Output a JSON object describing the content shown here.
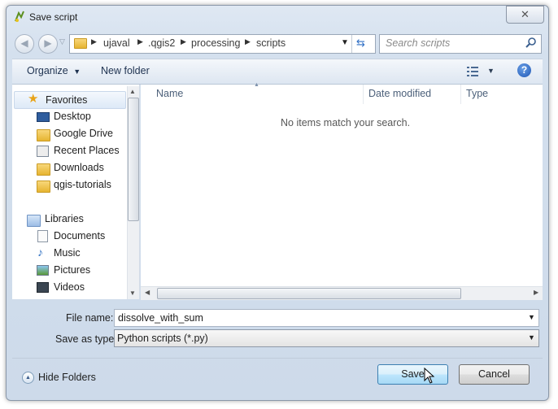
{
  "window": {
    "title": "Save script",
    "close_glyph": "✕"
  },
  "address_bar": {
    "segments": [
      "ujaval",
      ".qgis2",
      "processing",
      "scripts"
    ],
    "refresh_glyph": "⇆"
  },
  "search": {
    "placeholder": "Search scripts"
  },
  "toolbar": {
    "organize_label": "Organize",
    "new_folder_label": "New folder",
    "help_glyph": "?"
  },
  "nav_pane": {
    "favorites_label": "Favorites",
    "favorites": [
      "Desktop",
      "Google Drive",
      "Recent Places",
      "Downloads",
      "qgis-tutorials"
    ],
    "libraries_label": "Libraries",
    "libraries": [
      "Documents",
      "Music",
      "Pictures",
      "Videos"
    ]
  },
  "file_list": {
    "columns": [
      "Name",
      "Date modified",
      "Type"
    ],
    "empty_message": "No items match your search."
  },
  "form": {
    "file_name_label": "File name:",
    "file_name_value": "dissolve_with_sum",
    "save_as_type_label": "Save as type:",
    "save_as_type_value": "Python scripts (*.py)"
  },
  "footer": {
    "hide_folders_label": "Hide Folders",
    "save_label": "Save",
    "cancel_label": "Cancel"
  },
  "colors": {
    "chrome": "#d4e0ee",
    "accent": "#1f57b5",
    "default_button": "#bee6fd"
  }
}
